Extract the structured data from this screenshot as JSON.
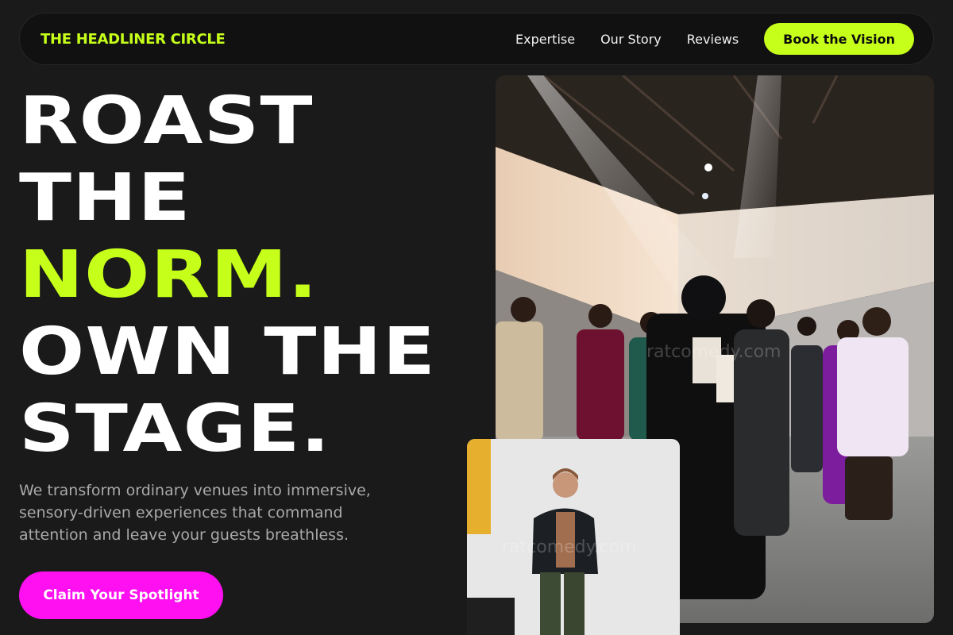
{
  "nav": {
    "brand": "THE HEADLINER CIRCLE",
    "links": [
      "Expertise",
      "Our Story",
      "Reviews"
    ],
    "cta_label": "Book the Vision"
  },
  "hero": {
    "title_lines": [
      "ROAST",
      "THE",
      "NORM.",
      "OWN THE",
      "STAGE."
    ],
    "description": "We transform ordinary venues into immersive, sensory-driven experiences that command attention and leave your guests breathless.",
    "cta_label": "Claim Your Spotlight"
  },
  "images": {
    "main_watermark": "ratcomedy.com",
    "small_watermark": "ratcomedy.com"
  },
  "colors": {
    "background": "#1a1a1a",
    "accent_lime": "#c6ff1a",
    "accent_magenta": "#ff10f0"
  }
}
